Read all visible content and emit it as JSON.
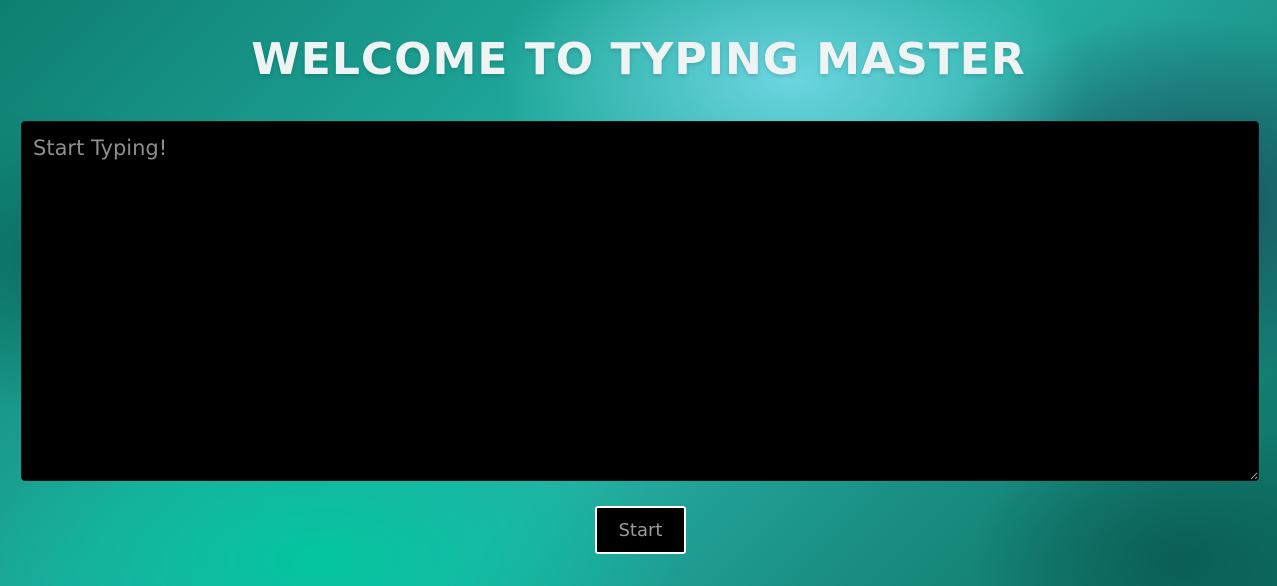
{
  "header": {
    "title": "WELCOME TO TYPING MASTER"
  },
  "typing_area": {
    "placeholder": "Start Typing!",
    "value": ""
  },
  "start_button": {
    "label": "Start"
  },
  "colors": {
    "title_text": "#eef4f4",
    "textarea_background": "#000000",
    "button_border": "#ffffff",
    "placeholder_text": "#8d8d8d"
  }
}
